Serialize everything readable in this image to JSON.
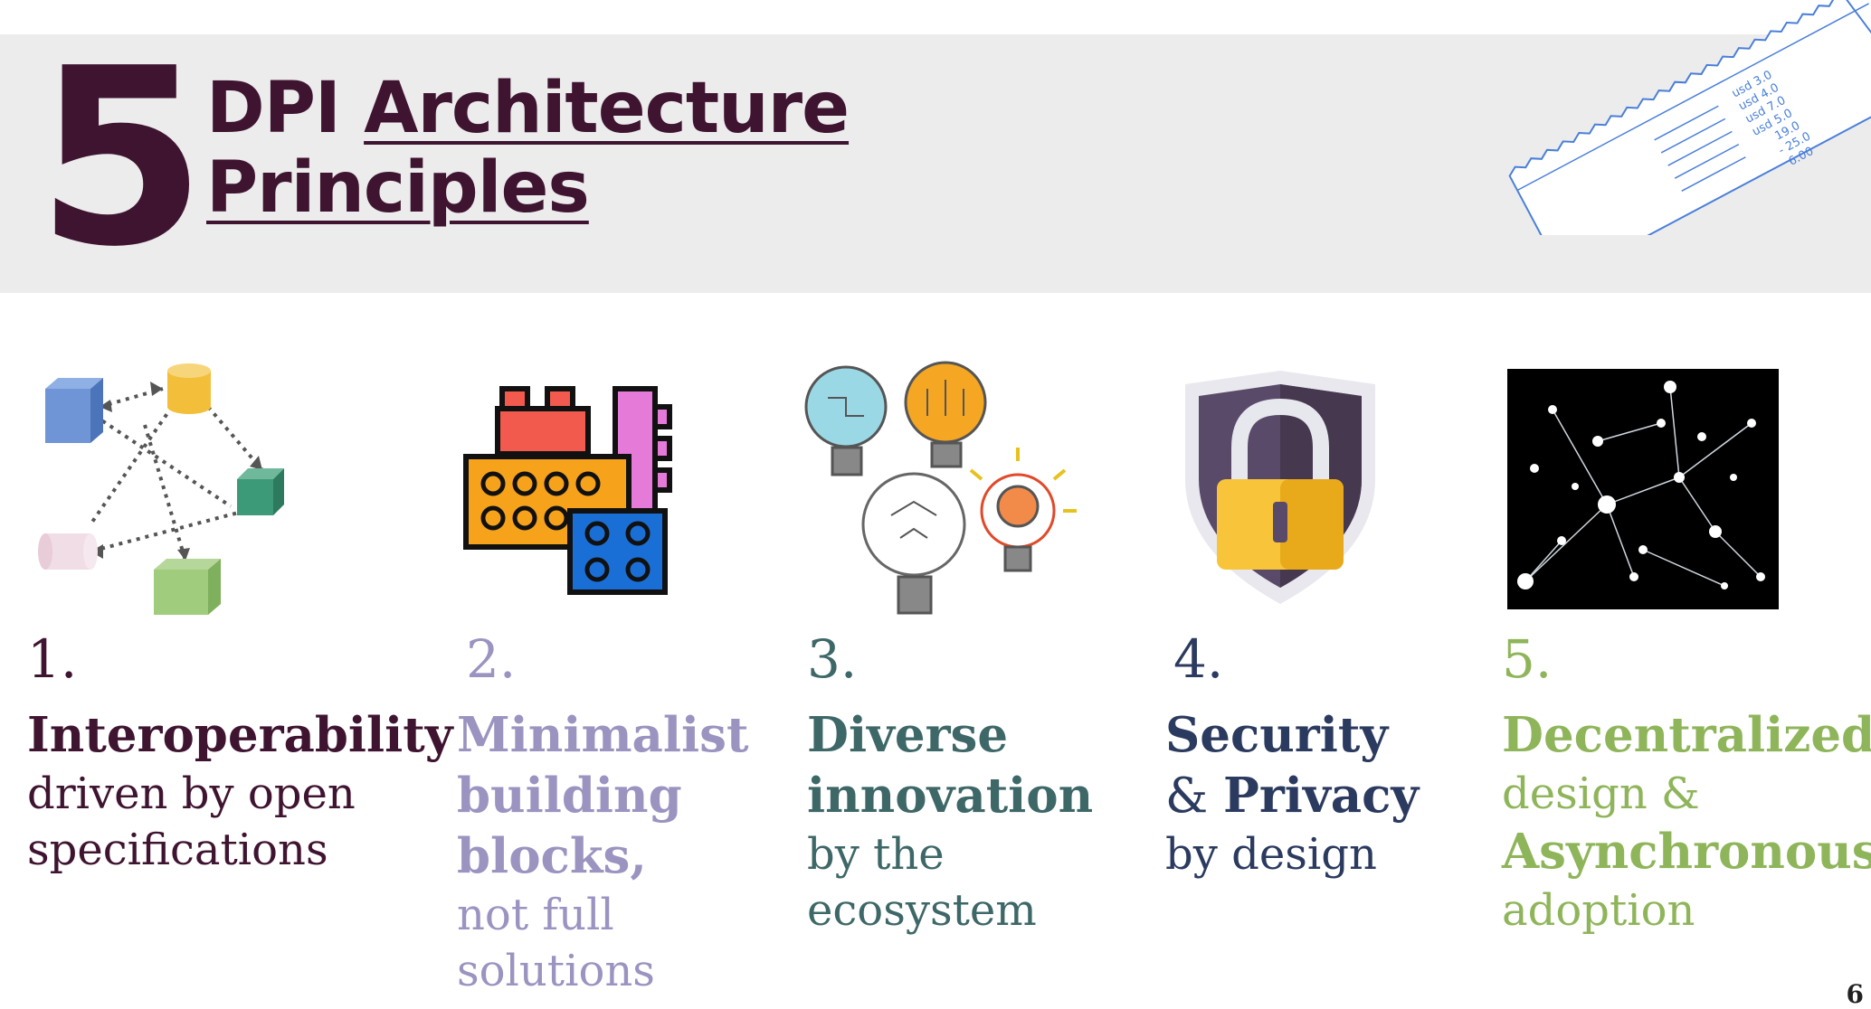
{
  "header": {
    "number": "5",
    "title_part1": "DPI ",
    "title_part2": "Architecture",
    "title_line2": "Principles"
  },
  "receipt": {
    "lines": [
      "usd  3.0",
      "usd  4.0",
      "usd  7.0",
      "usd  5.0",
      "19.0",
      "- 25.0",
      "6.00"
    ]
  },
  "principles": [
    {
      "number": "1.",
      "head": "Interoperability",
      "body1": "driven by open",
      "body2": "specifications",
      "icon": "connected-blocks-icon",
      "color": "#3f1430"
    },
    {
      "number": "2.",
      "head1": "Minimalist",
      "head2": "building",
      "head3": "blocks,",
      "body1": "not full",
      "body2": "solutions",
      "icon": "lego-blocks-icon",
      "color": "#9b93c0"
    },
    {
      "number": "3.",
      "head1": "Diverse",
      "head2": "innovation",
      "body1": "by the",
      "body2": "ecosystem",
      "icon": "lightbulbs-icon",
      "color": "#3e6767"
    },
    {
      "number": "4.",
      "head1": "Security",
      "amp": "& ",
      "head2": "Privacy",
      "body1": "by design",
      "icon": "shield-lock-icon",
      "color": "#2b3a5f"
    },
    {
      "number": "5.",
      "head1": "Decentralized",
      "body1": "design &",
      "head2": "Asynchronous",
      "body2": "adoption",
      "icon": "network-icon",
      "color": "#8fb55a"
    }
  ],
  "page_number": "6"
}
